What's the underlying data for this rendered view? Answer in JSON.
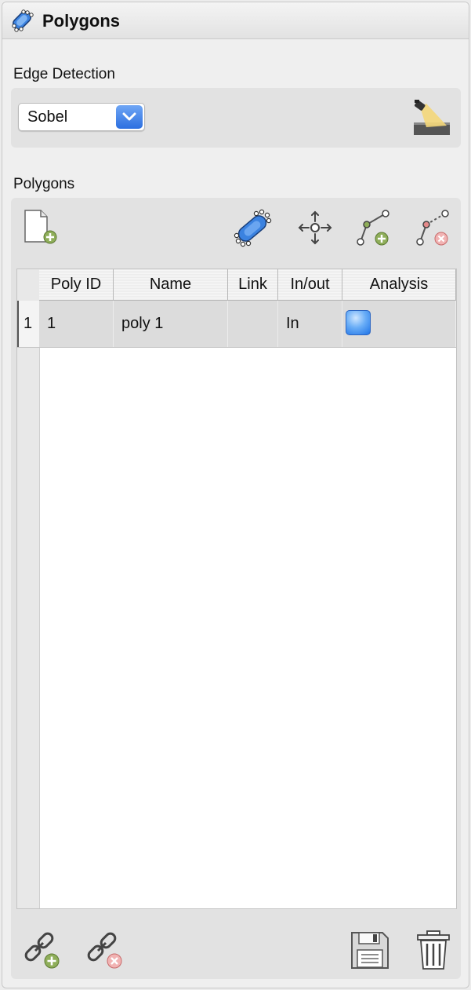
{
  "window": {
    "title": "Polygons",
    "icon": "polygon-icon"
  },
  "edge_detection": {
    "label": "Edge Detection",
    "method_value": "Sobel",
    "options_icon": "chevron-down-icon",
    "detect_icon": "spotlight-icon"
  },
  "polygons": {
    "label": "Polygons",
    "toolbar": [
      {
        "name": "new-polygon-file",
        "icon": "new-document-add-icon"
      },
      {
        "name": "select-polygon",
        "icon": "polygon-select-icon"
      },
      {
        "name": "move-polygon",
        "icon": "move-arrows-icon"
      },
      {
        "name": "add-vertex",
        "icon": "add-vertex-icon"
      },
      {
        "name": "remove-vertex",
        "icon": "remove-vertex-icon"
      }
    ],
    "table": {
      "columns": [
        "Poly ID",
        "Name",
        "Link",
        "In/out",
        "Analysis"
      ],
      "rows": [
        {
          "row_number": "1",
          "poly_id": "1",
          "name": "poly 1",
          "link": "",
          "in_out": "In",
          "analysis": "analysis-button"
        }
      ]
    },
    "bottom_toolbar": [
      {
        "name": "link-add",
        "icon": "link-add-icon"
      },
      {
        "name": "link-remove",
        "icon": "link-remove-icon"
      },
      {
        "name": "save",
        "icon": "floppy-disk-icon"
      },
      {
        "name": "delete",
        "icon": "trash-icon"
      }
    ]
  },
  "colors": {
    "accent": "#2c6fe0",
    "add_green": "#8fae5a",
    "remove_red": "#e58a8a"
  }
}
